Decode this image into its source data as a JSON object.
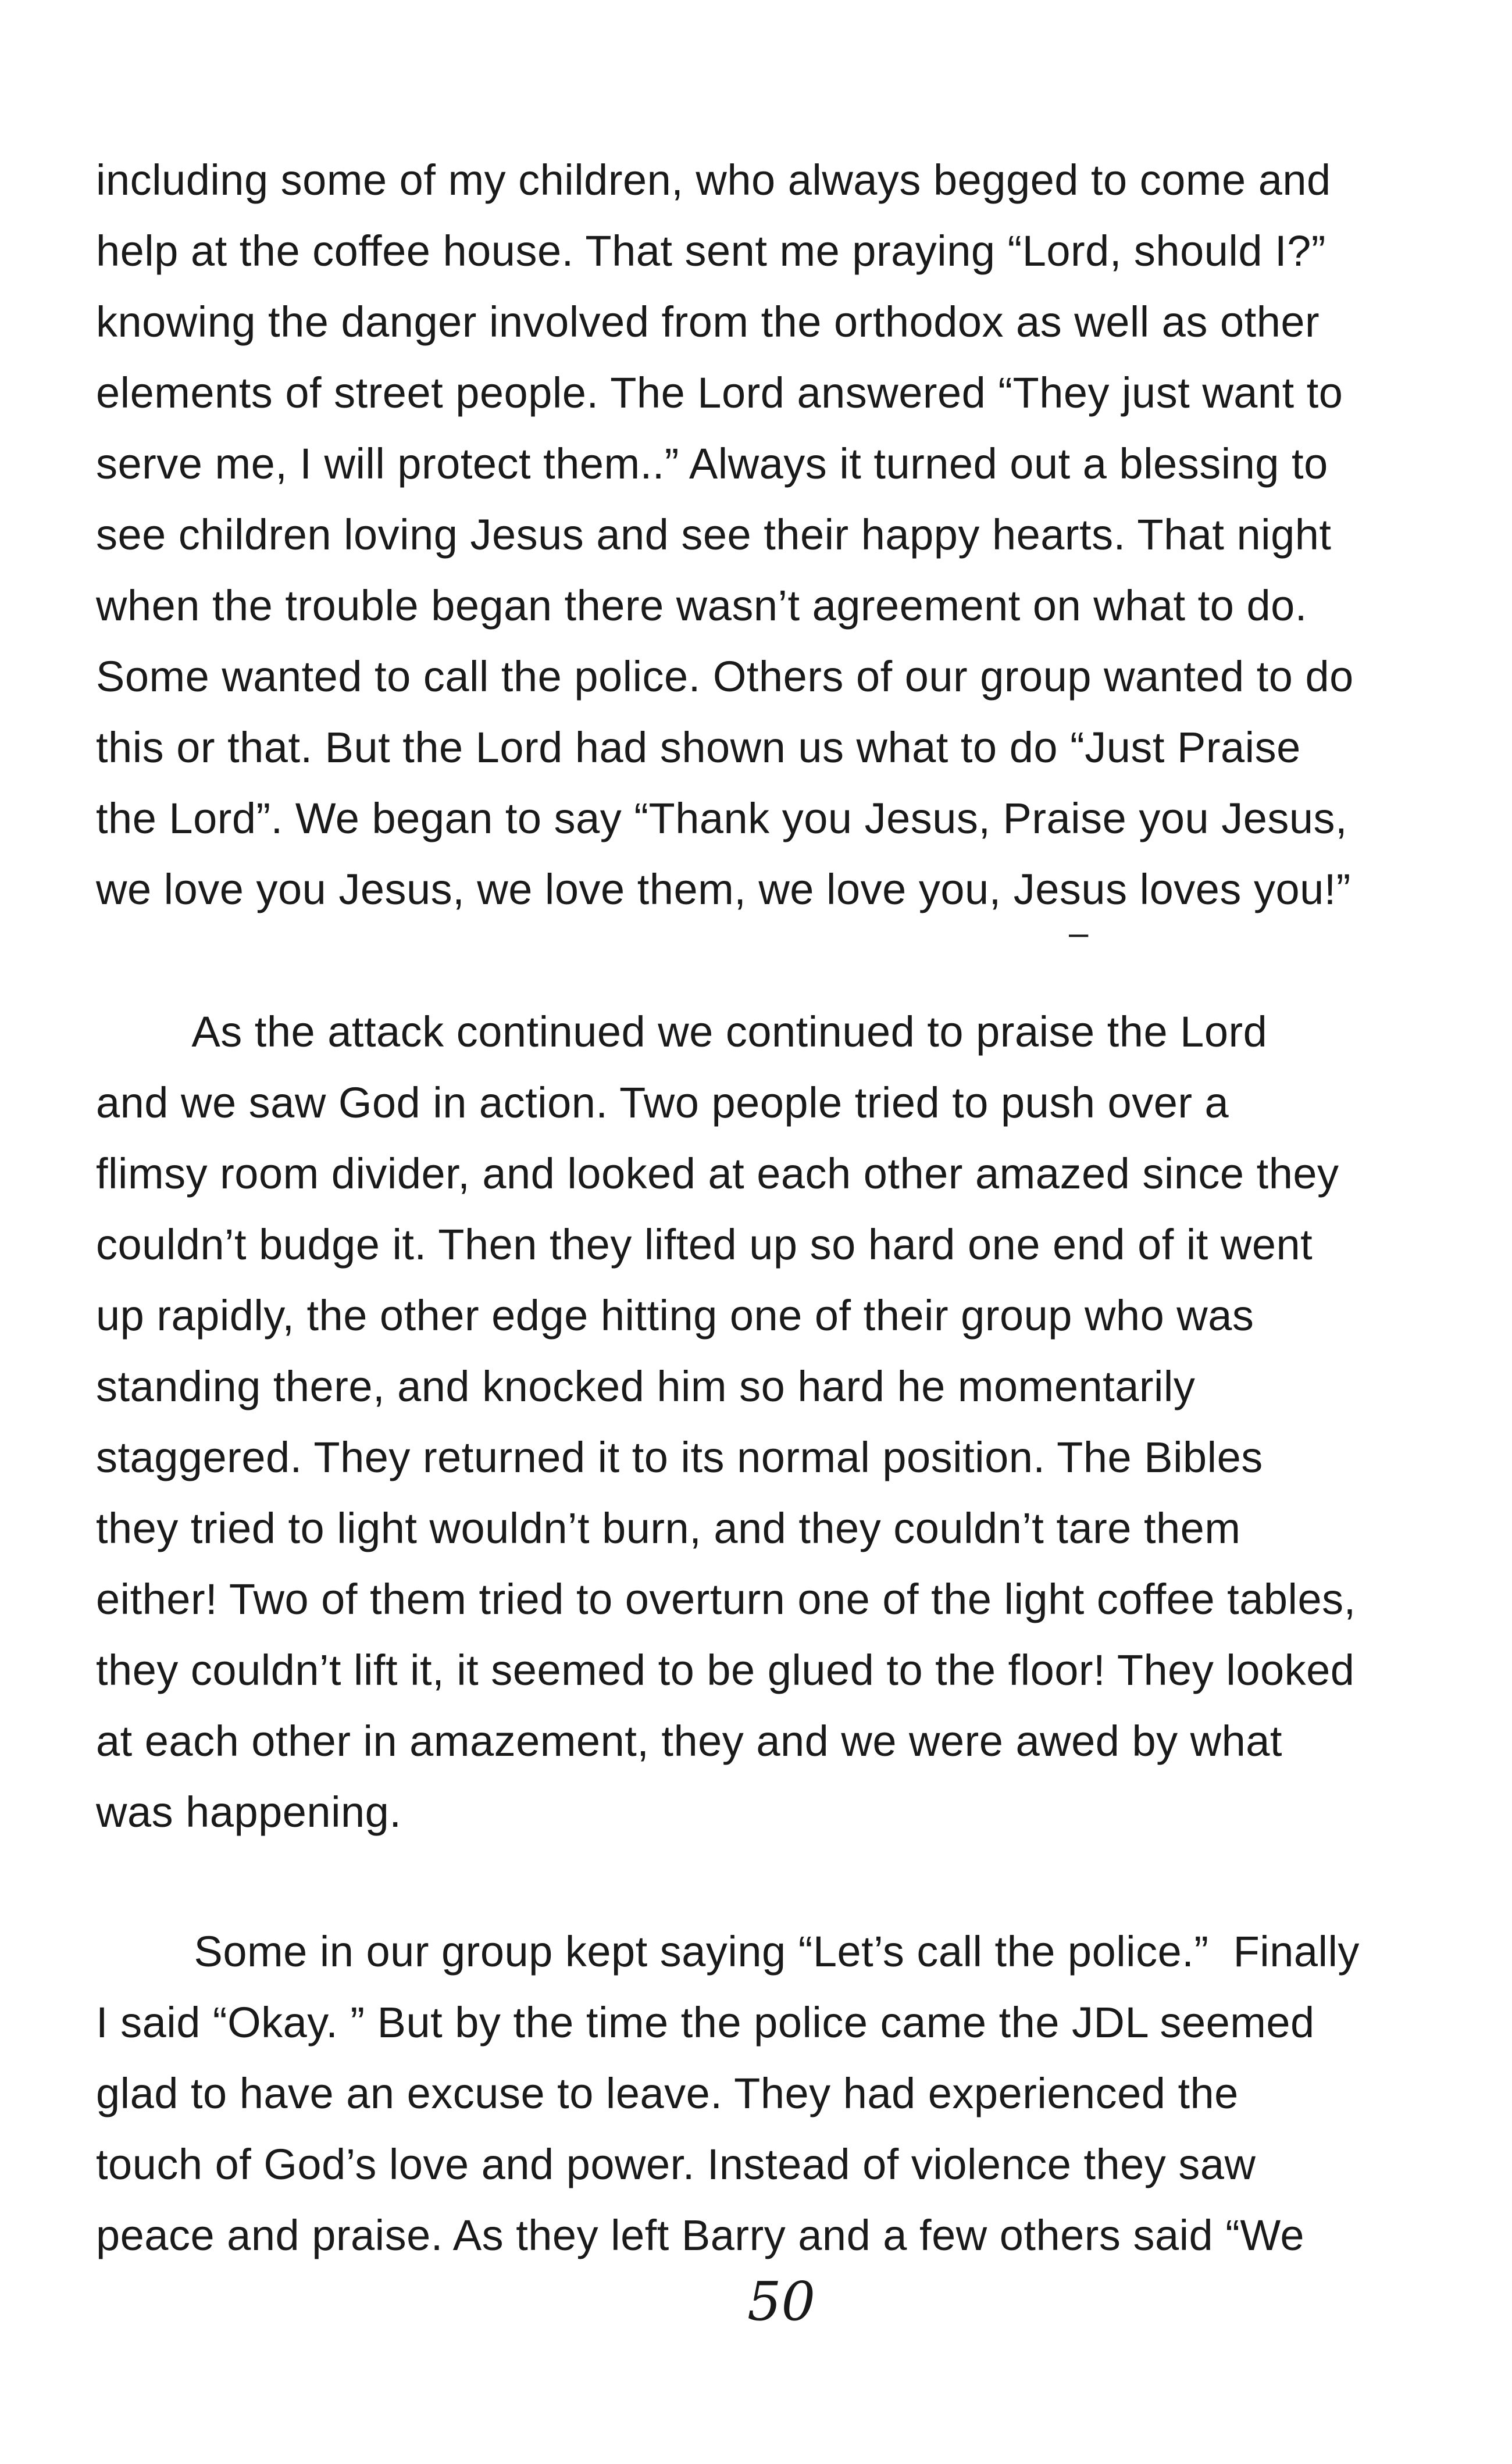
{
  "paragraphs": [
    {
      "lines": [
        "including some of my children, who always begged to come and",
        "help at the coffee house.  That sent me praying “Lord, should I?”",
        "knowing the danger involved from the orthodox as well as other",
        "elements of street people.  The Lord answered “They just want to",
        "serve me, I will protect them..”  Always it turned out a blessing to",
        "see children loving Jesus and see their happy hearts.  That night",
        "when the trouble began there wasn’t agreement on what to do.",
        "Some wanted to call the police. Others of our group wanted to do",
        "this or that.  But the Lord had shown us what to do “Just Praise",
        "the Lord”.  We began to say “Thank you Jesus, Praise you Jesus,",
        "we love you Jesus, we love them, we love you, Jesus loves you!”"
      ]
    },
    {
      "lines": [
        "        As the attack continued we continued to praise the Lord",
        "and we saw God in action.  Two people tried to push over a",
        "flimsy room divider, and looked at each other amazed since they",
        "couldn’t budge it.  Then they lifted up so hard one end of it went",
        "up rapidly, the other edge hitting one of their group who was",
        "standing there, and knocked him so hard he momentarily",
        "staggered.  They returned it to its normal position.  The Bibles",
        "they tried to light  wouldn’t burn, and they couldn’t tare them",
        "either!  Two of them tried to overturn one of the light coffee tables,",
        "they couldn’t lift it, it seemed to be glued to the floor! They looked",
        "at each other in amazement, they and we were awed by what",
        "was happening."
      ]
    },
    {
      "lines": [
        "        Some in our group kept saying “Let’s call the police.”  Finally",
        "I said “Okay. ”  But by the time the police came the JDL seemed",
        "glad to have an excuse to leave.  They had experienced the",
        "touch of God’s love and power. Instead of violence they saw",
        "peace and praise.  As they left Barry and a few others said “We"
      ]
    }
  ],
  "stray_mark": "–",
  "page_number": "50"
}
